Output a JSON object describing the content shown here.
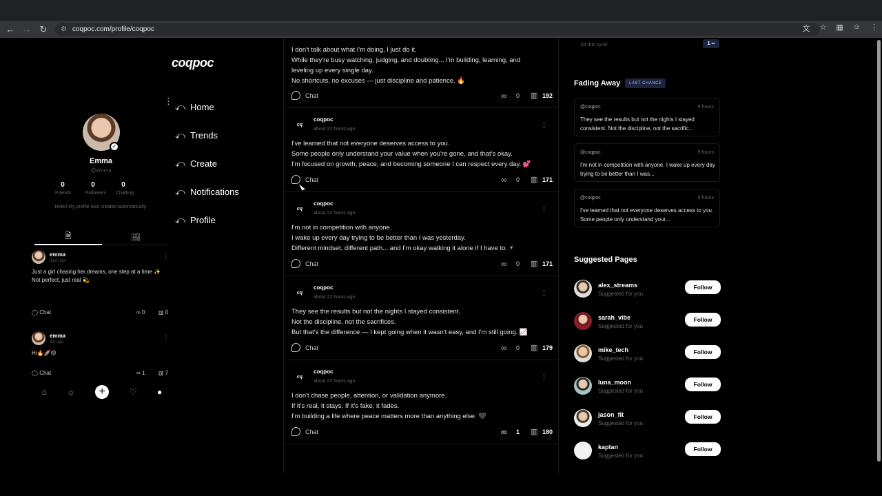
{
  "browser": {
    "url": "coqpoc.com/profile/coqpoc"
  },
  "brand": {
    "logo": "coqpoc"
  },
  "profile": {
    "name": "Emma",
    "handle": "@emma",
    "stats": [
      {
        "value": "0",
        "label": "Friends"
      },
      {
        "value": "0",
        "label": "Followers"
      },
      {
        "value": "0",
        "label": "Chatting"
      }
    ],
    "bio": "Hello! My profile was created automatically.",
    "posts": [
      {
        "user": "emma",
        "time": "Just now",
        "text1": "Just a girl chasing her dreams, one step at a time ✨",
        "text2": "Not perfect, just real 💫",
        "chat": "Chat",
        "infinity": "0",
        "views": "0"
      },
      {
        "user": "emma",
        "time": "9m ago",
        "text1": "Hi🔥🚀😝",
        "text2": "",
        "chat": "Chat",
        "infinity": "1",
        "views": "7"
      }
    ]
  },
  "nav": {
    "items": [
      {
        "label": "Home"
      },
      {
        "label": "Trends"
      },
      {
        "label": "Create"
      },
      {
        "label": "Notifications"
      },
      {
        "label": "Profile"
      }
    ]
  },
  "feed": {
    "posts": [
      {
        "user": "",
        "time": "",
        "lines": [
          "I don't talk about what I'm doing, I just do it.",
          "While they're busy watching, judging, and doubting... I'm building, learning, and",
          "leveling up every single day.",
          "No shortcuts, no excuses — just discipline and patience. 🔥"
        ],
        "chat": "Chat",
        "infinity": "0",
        "views": "192"
      },
      {
        "user": "coqpoc",
        "time": "about 22 hours ago",
        "lines": [
          "I've learned that not everyone deserves access to you.",
          "Some people only understand your value when you're gone, and that's okay.",
          "I'm focused on growth, peace, and becoming someone I can respect every day. 💕"
        ],
        "chat": "Chat",
        "infinity": "0",
        "views": "171"
      },
      {
        "user": "coqpoc",
        "time": "about 22 hours ago",
        "lines": [
          "I'm not in competition with anyone.",
          "I wake up every day trying to be better than I was yesterday.",
          "Different mindset, different path... and I'm okay walking it alone if I have to. ⚡"
        ],
        "chat": "Chat",
        "infinity": "0",
        "views": "171"
      },
      {
        "user": "coqpoc",
        "time": "about 22 hours ago",
        "lines": [
          "They see the results but not the nights I stayed consistent.",
          "Not the discipline, not the sacrifices.",
          "But that's the difference — I kept going when it wasn't easy, and I'm still going. 📈"
        ],
        "chat": "Chat",
        "infinity": "0",
        "views": "179"
      },
      {
        "user": "coqpoc",
        "time": "about 22 hours ago",
        "lines": [
          "I don't chase people, attention, or validation anymore.",
          "If it's real, it stays. If it's fake, it fades.",
          "I'm building a life where peace matters more than anything else. 🖤"
        ],
        "chat": "Chat",
        "infinity": "1",
        "views": "180"
      }
    ]
  },
  "right": {
    "top_sub": "#3 this cycle",
    "top_badge": "1 ∞",
    "fading_title": "Fading Away",
    "fading_badge": "LAST CHANCE",
    "fading": [
      {
        "handle": "@coqpoc",
        "time": "9 hours",
        "text": "They see the results but not the nights I stayed consistent. Not the discipline, not the sacrific..."
      },
      {
        "handle": "@coqpoc",
        "time": "9 hours",
        "text": "I'm not in competition with anyone. I wake up every day trying to be better than I was..."
      },
      {
        "handle": "@coqpoc",
        "time": "9 hours",
        "text": "I've learned that not everyone deserves access to you. Some people only understand your..."
      }
    ],
    "suggested_title": "Suggested Pages",
    "suggested": [
      {
        "name": "alex_streams",
        "sub": "Suggested for you",
        "action": "Follow"
      },
      {
        "name": "sarah_vibe",
        "sub": "Suggested for you",
        "action": "Follow"
      },
      {
        "name": "mike_tech",
        "sub": "Suggested for you",
        "action": "Follow"
      },
      {
        "name": "luna_moon",
        "sub": "Suggested for you",
        "action": "Follow"
      },
      {
        "name": "jason_fit",
        "sub": "Suggested for you",
        "action": "Follow"
      },
      {
        "name": "kaptan",
        "sub": "Suggested for you",
        "action": "Follow"
      }
    ]
  },
  "icons": {
    "back": "arrow-left-icon",
    "forward": "arrow-right-icon",
    "reload": "reload-icon",
    "chat": "chat-bubble-icon",
    "infinity": "infinity-icon",
    "views": "bar-chart-icon"
  }
}
